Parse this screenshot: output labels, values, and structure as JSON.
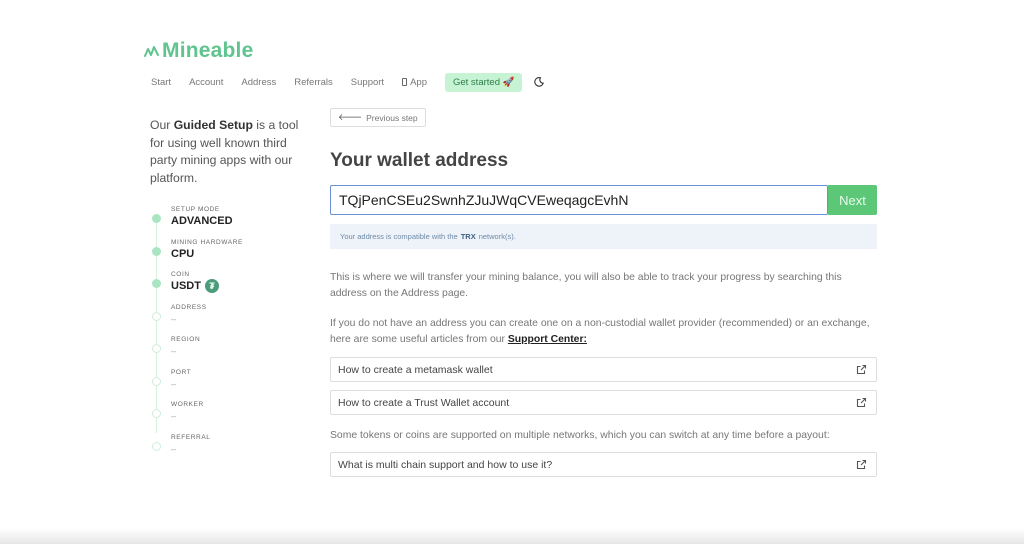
{
  "brand": {
    "name": "Mineable",
    "color": "#5fc48e"
  },
  "nav": {
    "items": [
      "Start",
      "Account",
      "Address",
      "Referrals",
      "Support"
    ],
    "app_label": "App",
    "cta_label": "Get started 🚀"
  },
  "intro": {
    "before": "Our ",
    "bold": "Guided Setup",
    "after": " is a tool for using well known third party mining apps with our platform."
  },
  "steps": [
    {
      "label": "SETUP MODE",
      "value": "ADVANCED",
      "done": true
    },
    {
      "label": "MINING HARDWARE",
      "value": "CPU",
      "done": true
    },
    {
      "label": "COIN",
      "value": "USDT",
      "done": true
    },
    {
      "label": "ADDRESS",
      "value": "–",
      "done": false
    },
    {
      "label": "REGION",
      "value": "–",
      "done": false
    },
    {
      "label": "PORT",
      "value": "–",
      "done": false
    },
    {
      "label": "WORKER",
      "value": "–",
      "done": false
    },
    {
      "label": "REFERRAL",
      "value": "–",
      "done": false
    }
  ],
  "main": {
    "prev_label": "Previous step",
    "title": "Your wallet address",
    "address_value": "TQjPenCSEu2SwnhZJuJWqCVEweqagcEvhN",
    "next_label": "Next",
    "compat": {
      "before": "Your address is compatible with the",
      "network": "TRX",
      "after": "network(s)."
    },
    "para1": "This is where we will transfer your mining balance, you will also be able to track your progress by searching this address on the Address page.",
    "para2_text": "If you do not have an address you can create one on a non-custodial wallet provider (recommended) or an exchange, here are some useful articles from our ",
    "para2_link": "Support Center:",
    "link1": "How to create a metamask wallet",
    "link2": "How to create a Trust Wallet account",
    "para3": "Some tokens or coins are supported on multiple networks, which you can switch at any time before a payout:",
    "link3": "What is multi chain support and how to use it?"
  }
}
